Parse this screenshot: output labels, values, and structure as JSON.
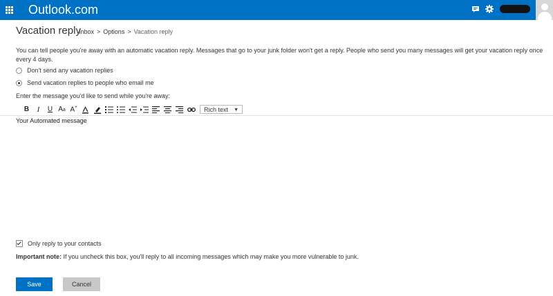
{
  "header": {
    "brand": "Outlook.com",
    "icons": [
      "waffle-icon",
      "chat-icon",
      "gear-icon",
      "avatar"
    ]
  },
  "page": {
    "title": "Vacation reply",
    "breadcrumb": [
      "Inbox",
      "Options",
      "Vacation reply"
    ],
    "breadcrumb_sep": ">"
  },
  "description": "You can tell people you're away with an automatic vacation reply. Messages that go to your junk folder won't get a reply. People who send you many messages will get your vacation reply once every 4 days.",
  "options": {
    "dont_send": "Don't send any vacation replies",
    "send": "Send vacation replies to people who email me",
    "selected": "send"
  },
  "editor": {
    "prompt": "Enter the message you'd like to send while you're away:",
    "toolbar": [
      "bold-icon",
      "italic-icon",
      "underline-icon",
      "font-size-icon",
      "font-grow-icon",
      "font-color-icon",
      "highlight-icon",
      "numbered-list-icon",
      "bullet-list-icon",
      "decrease-indent-icon",
      "increase-indent-icon",
      "align-left-icon",
      "align-center-icon",
      "align-right-icon",
      "link-icon"
    ],
    "format_value": "Rich text",
    "content": "Your Automated message"
  },
  "contacts_only": {
    "label": "Only reply to your contacts",
    "checked": true
  },
  "note": {
    "label": "Important note:",
    "text": " If you uncheck this box, you'll reply to all incoming messages which may make you more vulnerable to junk."
  },
  "actions": {
    "save": "Save",
    "cancel": "Cancel"
  },
  "colors": {
    "accent": "#0072c6",
    "cancel_bg": "#c8c8c8"
  }
}
